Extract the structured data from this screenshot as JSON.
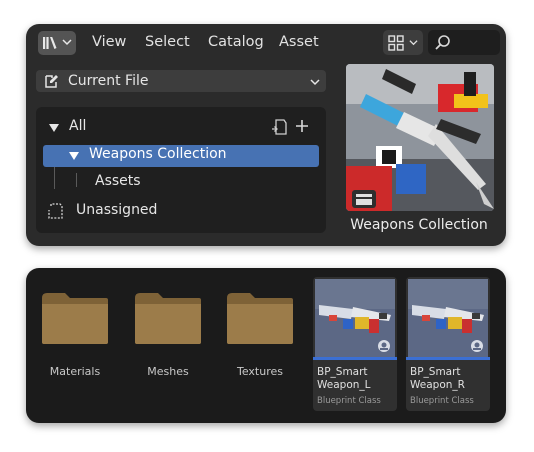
{
  "asset_browser": {
    "menu": {
      "view": "View",
      "select": "Select",
      "catalog": "Catalog",
      "asset": "Asset"
    },
    "icons": {
      "editor_type": "asset-browser-icon",
      "display_mode": "grid-icon",
      "search": "search-icon"
    },
    "library_dropdown": {
      "selected": "Current File"
    },
    "catalog_tree": {
      "root": "All",
      "items": [
        {
          "label": "Weapons Collection",
          "selected": true
        },
        {
          "label": "Assets",
          "selected": false
        }
      ],
      "unassigned": "Unassigned"
    },
    "preview": {
      "caption": "Weapons Collection"
    }
  },
  "content_browser": {
    "folders": [
      {
        "label": "Materials"
      },
      {
        "label": "Meshes"
      },
      {
        "label": "Textures"
      }
    ],
    "assets": [
      {
        "name_line1": "BP_Smart",
        "name_line2": "Weapon_L",
        "type": "Blueprint Class"
      },
      {
        "name_line1": "BP_Smart",
        "name_line2": "Weapon_R",
        "type": "Blueprint Class"
      }
    ]
  },
  "colors": {
    "selection": "#4772b3",
    "panel": "#2b2b2b",
    "folder": "#9c7c4a",
    "asset_underline": "#3b6fd4"
  }
}
